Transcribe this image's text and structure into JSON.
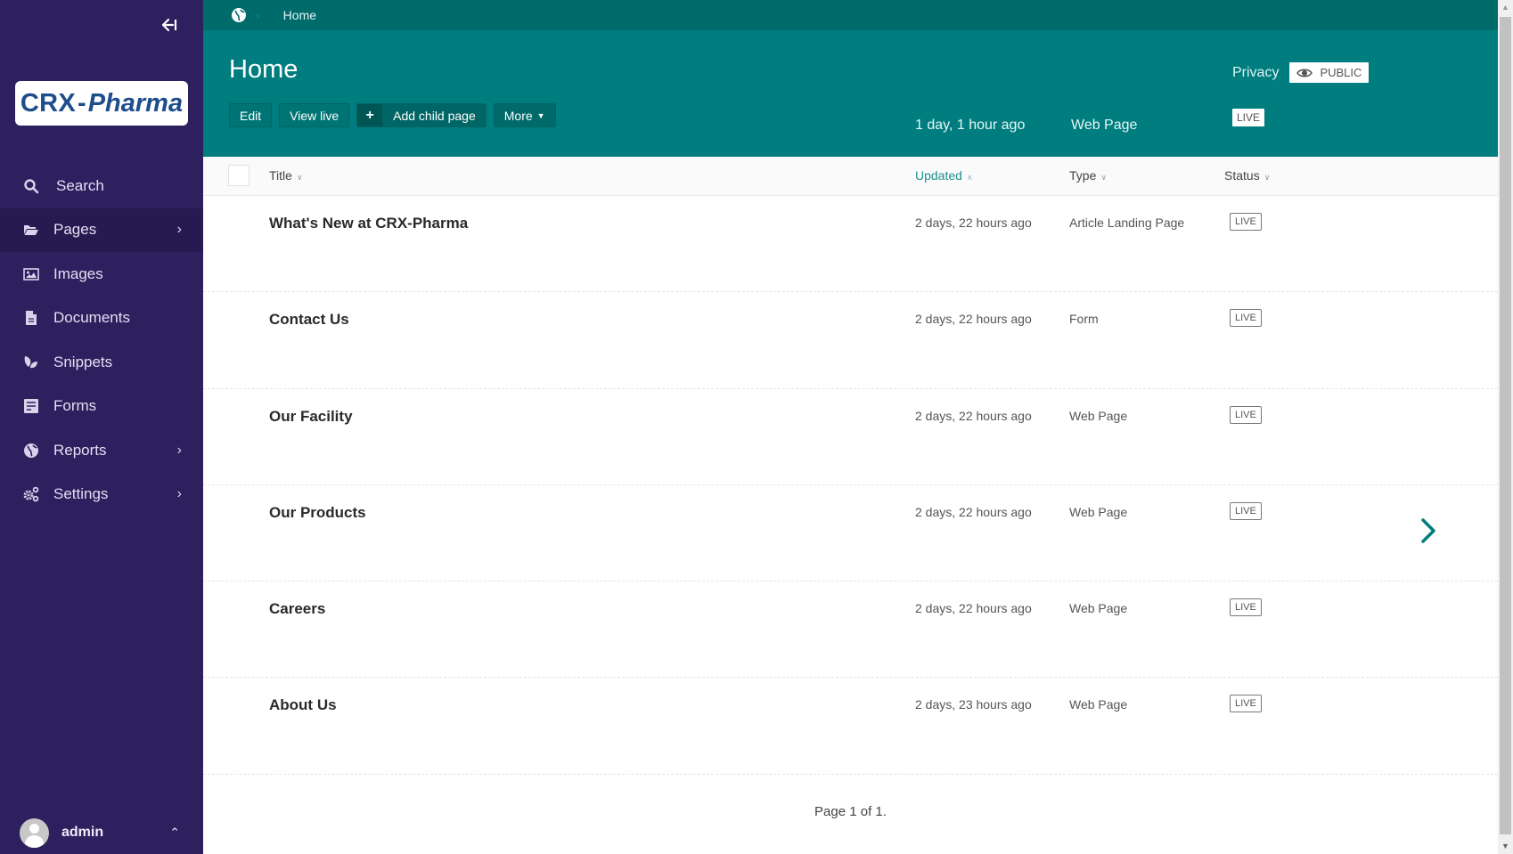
{
  "sidebar": {
    "collapse_icon": "collapse-left-icon",
    "logo": {
      "part1": "CRX",
      "dash": "-",
      "part2": "Pharma"
    },
    "items": [
      {
        "label": "Search",
        "icon": "search-icon",
        "has_submenu": false,
        "active": false
      },
      {
        "label": "Pages",
        "icon": "folder-open-icon",
        "has_submenu": true,
        "active": true
      },
      {
        "label": "Images",
        "icon": "image-icon",
        "has_submenu": false,
        "active": false
      },
      {
        "label": "Documents",
        "icon": "document-icon",
        "has_submenu": false,
        "active": false
      },
      {
        "label": "Snippets",
        "icon": "snippets-leaf-icon",
        "has_submenu": false,
        "active": false
      },
      {
        "label": "Forms",
        "icon": "form-icon",
        "has_submenu": false,
        "active": false
      },
      {
        "label": "Reports",
        "icon": "globe-icon",
        "has_submenu": true,
        "active": false
      },
      {
        "label": "Settings",
        "icon": "cogs-icon",
        "has_submenu": true,
        "active": false
      }
    ],
    "chevron": "›",
    "account": {
      "name": "admin",
      "chevron": "⌃"
    }
  },
  "breadcrumb": {
    "root_icon": "globe-icon",
    "separator": "›",
    "items": [
      "Home"
    ]
  },
  "header": {
    "title": "Home",
    "actions": {
      "edit": "Edit",
      "view_live": "View live",
      "add_child_plus": "+",
      "add_child": "Add child page",
      "more": "More",
      "more_caret": "⌄"
    },
    "privacy": {
      "label": "Privacy",
      "value": "PUBLIC"
    },
    "updated": "1 day, 1 hour ago",
    "type": "Web Page",
    "status": "LIVE"
  },
  "table": {
    "columns": {
      "title": "Title",
      "updated": "Updated",
      "type": "Type",
      "status": "Status",
      "sort_down": "⌄",
      "sort_up": "⌃"
    },
    "rows": [
      {
        "title": "What's New at CRX-Pharma",
        "updated": "2 days, 22 hours ago",
        "type": "Article Landing Page",
        "status": "LIVE",
        "has_children": false
      },
      {
        "title": "Contact Us",
        "updated": "2 days, 22 hours ago",
        "type": "Form",
        "status": "LIVE",
        "has_children": false
      },
      {
        "title": "Our Facility",
        "updated": "2 days, 22 hours ago",
        "type": "Web Page",
        "status": "LIVE",
        "has_children": false
      },
      {
        "title": "Our Products",
        "updated": "2 days, 22 hours ago",
        "type": "Web Page",
        "status": "LIVE",
        "has_children": true
      },
      {
        "title": "Careers",
        "updated": "2 days, 22 hours ago",
        "type": "Web Page",
        "status": "LIVE",
        "has_children": false
      },
      {
        "title": "About Us",
        "updated": "2 days, 23 hours ago",
        "type": "Web Page",
        "status": "LIVE",
        "has_children": false
      }
    ]
  },
  "pagination": {
    "text": "Page 1 of 1."
  },
  "colors": {
    "sidebar_bg": "#2e1f5e",
    "header_teal": "#007d7e",
    "breadcrumb_teal": "#006b6b",
    "accent": "#007d7e"
  }
}
